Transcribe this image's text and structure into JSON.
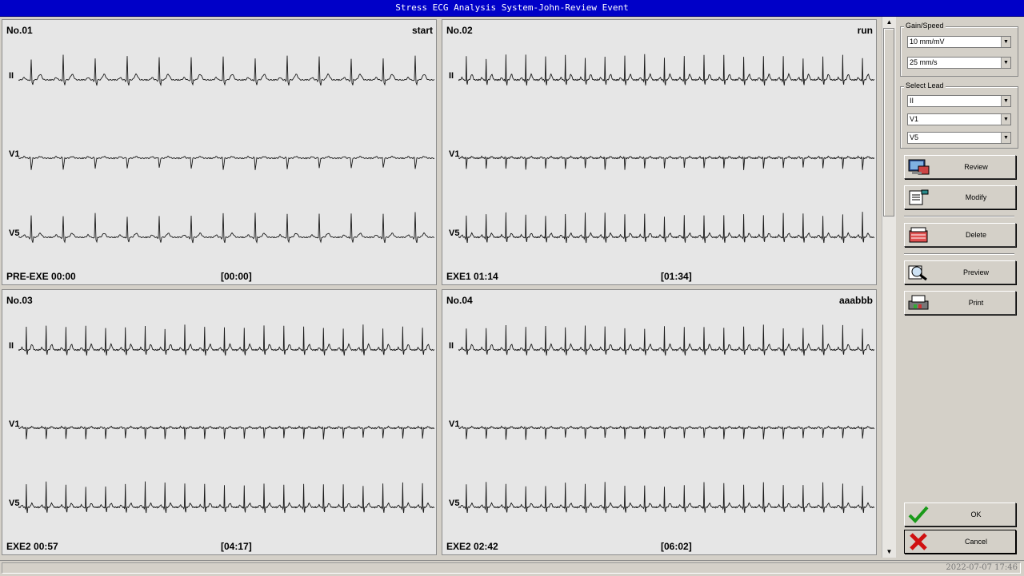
{
  "window": {
    "title": "Stress ECG Analysis System-John-Review Event"
  },
  "events": [
    {
      "no": "No.01",
      "tag": "start",
      "stage": "PRE-EXE  00:00",
      "elapsed": "[00:00]",
      "leads": [
        "II",
        "V1",
        "V5"
      ],
      "hr": 13
    },
    {
      "no": "No.02",
      "tag": "run",
      "stage": "EXE1  01:14",
      "elapsed": "[01:34]",
      "leads": [
        "II",
        "V1",
        "V5"
      ],
      "hr": 21
    },
    {
      "no": "No.03",
      "tag": "",
      "stage": "EXE2  00:57",
      "elapsed": "[04:17]",
      "leads": [
        "II",
        "V1",
        "V5"
      ],
      "hr": 21
    },
    {
      "no": "No.04",
      "tag": "aaabbb",
      "stage": "EXE2  02:42",
      "elapsed": "[06:02]",
      "leads": [
        "II",
        "V1",
        "V5"
      ],
      "hr": 21
    }
  ],
  "sidebar": {
    "gain_speed": {
      "legend": "Gain/Speed",
      "gain": "10 mm/mV",
      "speed": "25 mm/s"
    },
    "select_lead": {
      "legend": "Select Lead",
      "lead1": "II",
      "lead2": "V1",
      "lead3": "V5"
    },
    "buttons": {
      "review": "Review",
      "modify": "Modify",
      "delete": "Delete",
      "preview": "Preview",
      "print": "Print",
      "ok": "OK",
      "cancel": "Cancel"
    }
  },
  "status": {
    "clock": "2022-07-07 17:46"
  },
  "colors": {
    "titlebar": "#0000c8",
    "panel": "#e6e6e6",
    "trace": "#1a1a1a"
  }
}
